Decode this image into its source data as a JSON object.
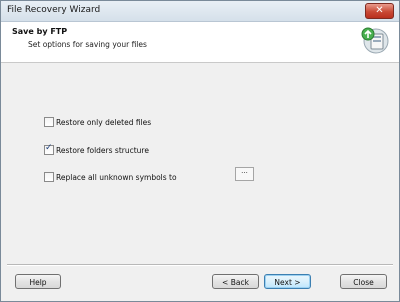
{
  "window": {
    "title": "File Recovery Wizard",
    "close_label": "✕"
  },
  "header": {
    "title": "Save by FTP",
    "subtitle": "Set options for saving your files",
    "icon": "ftp-save-icon"
  },
  "options": [
    {
      "label": "Restore only deleted files",
      "checked": false
    },
    {
      "label": "Restore folders structure",
      "checked": true
    },
    {
      "label": "Replace all unknown symbols to",
      "checked": false
    }
  ],
  "symbol_button": {
    "label": "..."
  },
  "footer": {
    "help": "Help",
    "back": "< Back",
    "next": "Next >",
    "close": "Close"
  }
}
